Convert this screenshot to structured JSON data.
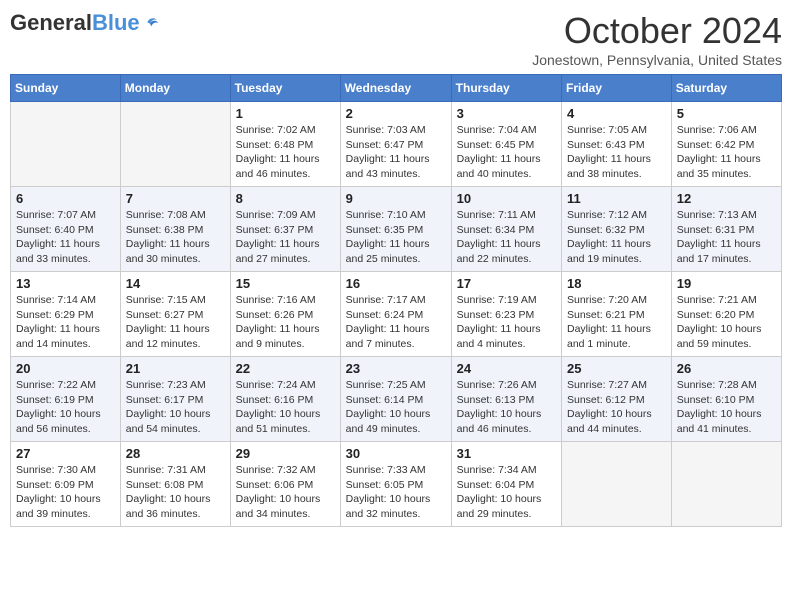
{
  "header": {
    "logo_general": "General",
    "logo_blue": "Blue",
    "month_title": "October 2024",
    "location": "Jonestown, Pennsylvania, United States"
  },
  "days_of_week": [
    "Sunday",
    "Monday",
    "Tuesday",
    "Wednesday",
    "Thursday",
    "Friday",
    "Saturday"
  ],
  "weeks": [
    [
      {
        "day": "",
        "empty": true
      },
      {
        "day": "",
        "empty": true
      },
      {
        "day": "1",
        "sunrise": "Sunrise: 7:02 AM",
        "sunset": "Sunset: 6:48 PM",
        "daylight": "Daylight: 11 hours and 46 minutes."
      },
      {
        "day": "2",
        "sunrise": "Sunrise: 7:03 AM",
        "sunset": "Sunset: 6:47 PM",
        "daylight": "Daylight: 11 hours and 43 minutes."
      },
      {
        "day": "3",
        "sunrise": "Sunrise: 7:04 AM",
        "sunset": "Sunset: 6:45 PM",
        "daylight": "Daylight: 11 hours and 40 minutes."
      },
      {
        "day": "4",
        "sunrise": "Sunrise: 7:05 AM",
        "sunset": "Sunset: 6:43 PM",
        "daylight": "Daylight: 11 hours and 38 minutes."
      },
      {
        "day": "5",
        "sunrise": "Sunrise: 7:06 AM",
        "sunset": "Sunset: 6:42 PM",
        "daylight": "Daylight: 11 hours and 35 minutes."
      }
    ],
    [
      {
        "day": "6",
        "sunrise": "Sunrise: 7:07 AM",
        "sunset": "Sunset: 6:40 PM",
        "daylight": "Daylight: 11 hours and 33 minutes."
      },
      {
        "day": "7",
        "sunrise": "Sunrise: 7:08 AM",
        "sunset": "Sunset: 6:38 PM",
        "daylight": "Daylight: 11 hours and 30 minutes."
      },
      {
        "day": "8",
        "sunrise": "Sunrise: 7:09 AM",
        "sunset": "Sunset: 6:37 PM",
        "daylight": "Daylight: 11 hours and 27 minutes."
      },
      {
        "day": "9",
        "sunrise": "Sunrise: 7:10 AM",
        "sunset": "Sunset: 6:35 PM",
        "daylight": "Daylight: 11 hours and 25 minutes."
      },
      {
        "day": "10",
        "sunrise": "Sunrise: 7:11 AM",
        "sunset": "Sunset: 6:34 PM",
        "daylight": "Daylight: 11 hours and 22 minutes."
      },
      {
        "day": "11",
        "sunrise": "Sunrise: 7:12 AM",
        "sunset": "Sunset: 6:32 PM",
        "daylight": "Daylight: 11 hours and 19 minutes."
      },
      {
        "day": "12",
        "sunrise": "Sunrise: 7:13 AM",
        "sunset": "Sunset: 6:31 PM",
        "daylight": "Daylight: 11 hours and 17 minutes."
      }
    ],
    [
      {
        "day": "13",
        "sunrise": "Sunrise: 7:14 AM",
        "sunset": "Sunset: 6:29 PM",
        "daylight": "Daylight: 11 hours and 14 minutes."
      },
      {
        "day": "14",
        "sunrise": "Sunrise: 7:15 AM",
        "sunset": "Sunset: 6:27 PM",
        "daylight": "Daylight: 11 hours and 12 minutes."
      },
      {
        "day": "15",
        "sunrise": "Sunrise: 7:16 AM",
        "sunset": "Sunset: 6:26 PM",
        "daylight": "Daylight: 11 hours and 9 minutes."
      },
      {
        "day": "16",
        "sunrise": "Sunrise: 7:17 AM",
        "sunset": "Sunset: 6:24 PM",
        "daylight": "Daylight: 11 hours and 7 minutes."
      },
      {
        "day": "17",
        "sunrise": "Sunrise: 7:19 AM",
        "sunset": "Sunset: 6:23 PM",
        "daylight": "Daylight: 11 hours and 4 minutes."
      },
      {
        "day": "18",
        "sunrise": "Sunrise: 7:20 AM",
        "sunset": "Sunset: 6:21 PM",
        "daylight": "Daylight: 11 hours and 1 minute."
      },
      {
        "day": "19",
        "sunrise": "Sunrise: 7:21 AM",
        "sunset": "Sunset: 6:20 PM",
        "daylight": "Daylight: 10 hours and 59 minutes."
      }
    ],
    [
      {
        "day": "20",
        "sunrise": "Sunrise: 7:22 AM",
        "sunset": "Sunset: 6:19 PM",
        "daylight": "Daylight: 10 hours and 56 minutes."
      },
      {
        "day": "21",
        "sunrise": "Sunrise: 7:23 AM",
        "sunset": "Sunset: 6:17 PM",
        "daylight": "Daylight: 10 hours and 54 minutes."
      },
      {
        "day": "22",
        "sunrise": "Sunrise: 7:24 AM",
        "sunset": "Sunset: 6:16 PM",
        "daylight": "Daylight: 10 hours and 51 minutes."
      },
      {
        "day": "23",
        "sunrise": "Sunrise: 7:25 AM",
        "sunset": "Sunset: 6:14 PM",
        "daylight": "Daylight: 10 hours and 49 minutes."
      },
      {
        "day": "24",
        "sunrise": "Sunrise: 7:26 AM",
        "sunset": "Sunset: 6:13 PM",
        "daylight": "Daylight: 10 hours and 46 minutes."
      },
      {
        "day": "25",
        "sunrise": "Sunrise: 7:27 AM",
        "sunset": "Sunset: 6:12 PM",
        "daylight": "Daylight: 10 hours and 44 minutes."
      },
      {
        "day": "26",
        "sunrise": "Sunrise: 7:28 AM",
        "sunset": "Sunset: 6:10 PM",
        "daylight": "Daylight: 10 hours and 41 minutes."
      }
    ],
    [
      {
        "day": "27",
        "sunrise": "Sunrise: 7:30 AM",
        "sunset": "Sunset: 6:09 PM",
        "daylight": "Daylight: 10 hours and 39 minutes."
      },
      {
        "day": "28",
        "sunrise": "Sunrise: 7:31 AM",
        "sunset": "Sunset: 6:08 PM",
        "daylight": "Daylight: 10 hours and 36 minutes."
      },
      {
        "day": "29",
        "sunrise": "Sunrise: 7:32 AM",
        "sunset": "Sunset: 6:06 PM",
        "daylight": "Daylight: 10 hours and 34 minutes."
      },
      {
        "day": "30",
        "sunrise": "Sunrise: 7:33 AM",
        "sunset": "Sunset: 6:05 PM",
        "daylight": "Daylight: 10 hours and 32 minutes."
      },
      {
        "day": "31",
        "sunrise": "Sunrise: 7:34 AM",
        "sunset": "Sunset: 6:04 PM",
        "daylight": "Daylight: 10 hours and 29 minutes."
      },
      {
        "day": "",
        "empty": true
      },
      {
        "day": "",
        "empty": true
      }
    ]
  ]
}
